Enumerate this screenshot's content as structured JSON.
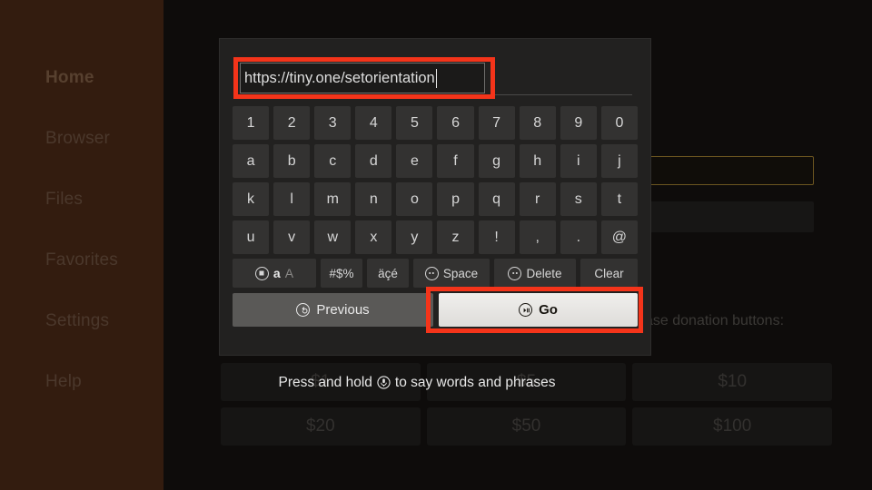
{
  "sidebar": {
    "items": [
      {
        "label": "Home",
        "active": true
      },
      {
        "label": "Browser",
        "active": false
      },
      {
        "label": "Files",
        "active": false
      },
      {
        "label": "Favorites",
        "active": false
      },
      {
        "label": "Settings",
        "active": false
      },
      {
        "label": "Help",
        "active": false
      }
    ]
  },
  "background": {
    "text_line_1": "ase donation buttons:",
    "text_line_2": ")",
    "donation_buttons": [
      "$1",
      "$5",
      "$10",
      "$20",
      "$50",
      "$100"
    ]
  },
  "voice_hint": {
    "text_before": "Press and hold",
    "text_after": "to say words and phrases",
    "icon": "microphone-icon"
  },
  "keyboard": {
    "url_value": "https://tiny.one/setorientation",
    "rows": [
      [
        "1",
        "2",
        "3",
        "4",
        "5",
        "6",
        "7",
        "8",
        "9",
        "0"
      ],
      [
        "a",
        "b",
        "c",
        "d",
        "e",
        "f",
        "g",
        "h",
        "i",
        "j"
      ],
      [
        "k",
        "l",
        "m",
        "n",
        "o",
        "p",
        "q",
        "r",
        "s",
        "t"
      ],
      [
        "u",
        "v",
        "w",
        "x",
        "y",
        "z",
        "!",
        ",",
        ".",
        "@"
      ]
    ],
    "function_keys": {
      "shift_lower": "a",
      "shift_upper": "A",
      "symbols": "#$%",
      "accents": "äçé",
      "space": "Space",
      "delete": "Delete",
      "clear": "Clear"
    },
    "actions": {
      "previous": "Previous",
      "go": "Go"
    }
  },
  "colors": {
    "highlight": "#f4341a",
    "sidebar_bg": "#331c0f",
    "modal_bg": "#222120",
    "key_bg": "#333231"
  }
}
